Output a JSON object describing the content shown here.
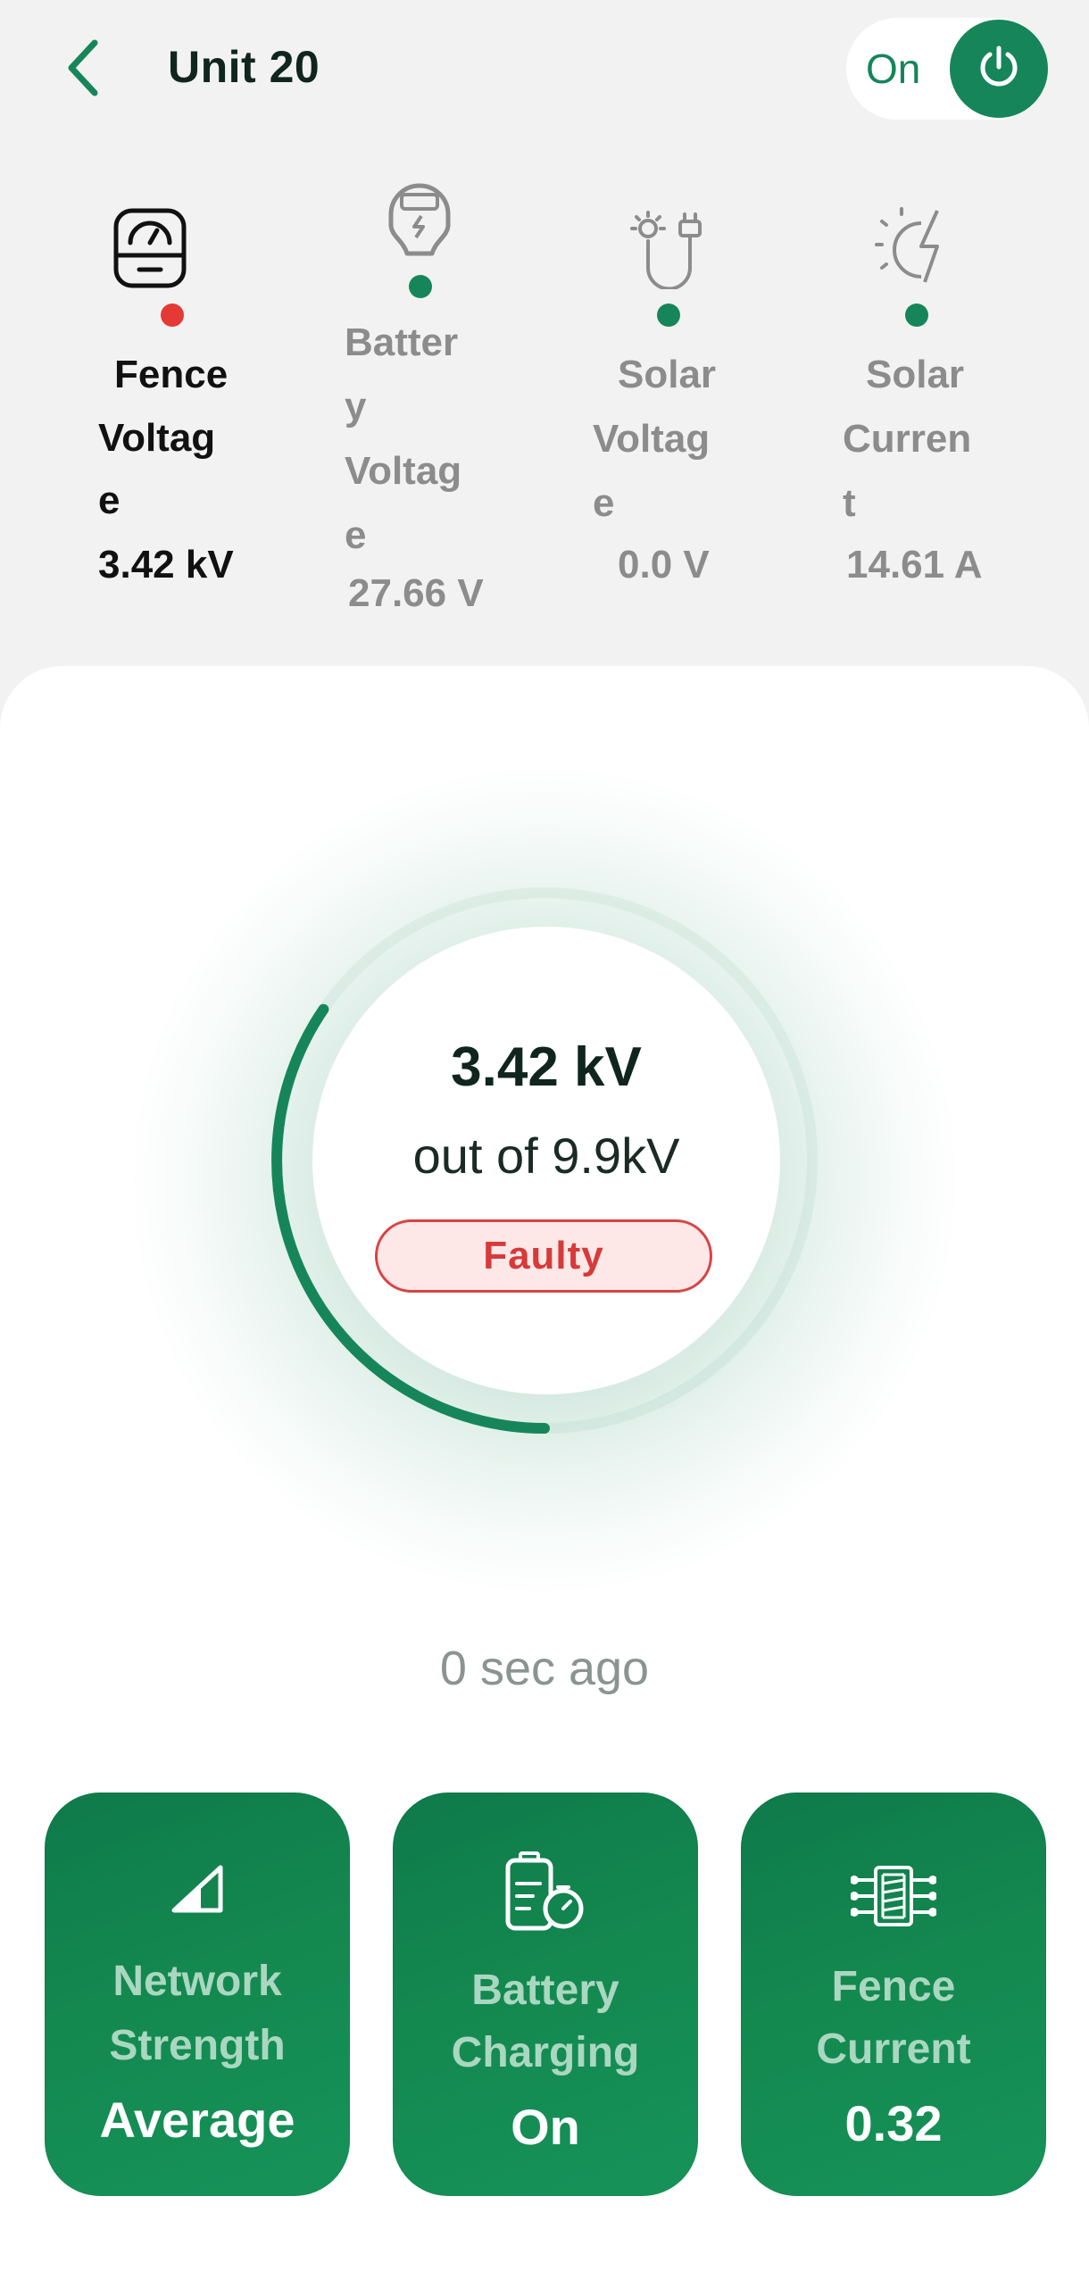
{
  "header": {
    "title": "Unit 20",
    "power_label": "On",
    "back_icon": "chevron-left-icon",
    "power_icon": "power-icon"
  },
  "metrics": [
    {
      "label": "Fence Voltage",
      "value": "3.42 kV",
      "icon": "fence-meter-icon",
      "status_color": "#e53935"
    },
    {
      "label": "Battery Voltage",
      "value": "27.66 V",
      "icon": "battery-meter-icon",
      "status_color": "#16865a"
    },
    {
      "label": "Solar Voltage",
      "value": "0.0 V",
      "icon": "solar-plug-icon",
      "status_color": "#16865a"
    },
    {
      "label": "Solar Current",
      "value": "14.61 A",
      "icon": "solar-bolt-icon",
      "status_color": "#16865a"
    }
  ],
  "gauge": {
    "value_text": "3.42 kV",
    "max_text": "out of 9.9kV",
    "value": 3.42,
    "max": 9.9,
    "status": "Faulty"
  },
  "last_updated": "0 sec ago",
  "tiles": [
    {
      "label_line1": "Network",
      "label_line2": "Strength",
      "value": "Average",
      "icon": "signal-strength-icon"
    },
    {
      "label_line1": "Battery",
      "label_line2": "Charging",
      "value": "On",
      "icon": "battery-timer-icon"
    },
    {
      "label_line1": "Fence",
      "label_line2": "Current",
      "value": "0.32",
      "icon": "fence-current-icon"
    }
  ],
  "colors": {
    "accent": "#16865a",
    "fault": "#d63a3a",
    "background": "#f2f2f2"
  }
}
